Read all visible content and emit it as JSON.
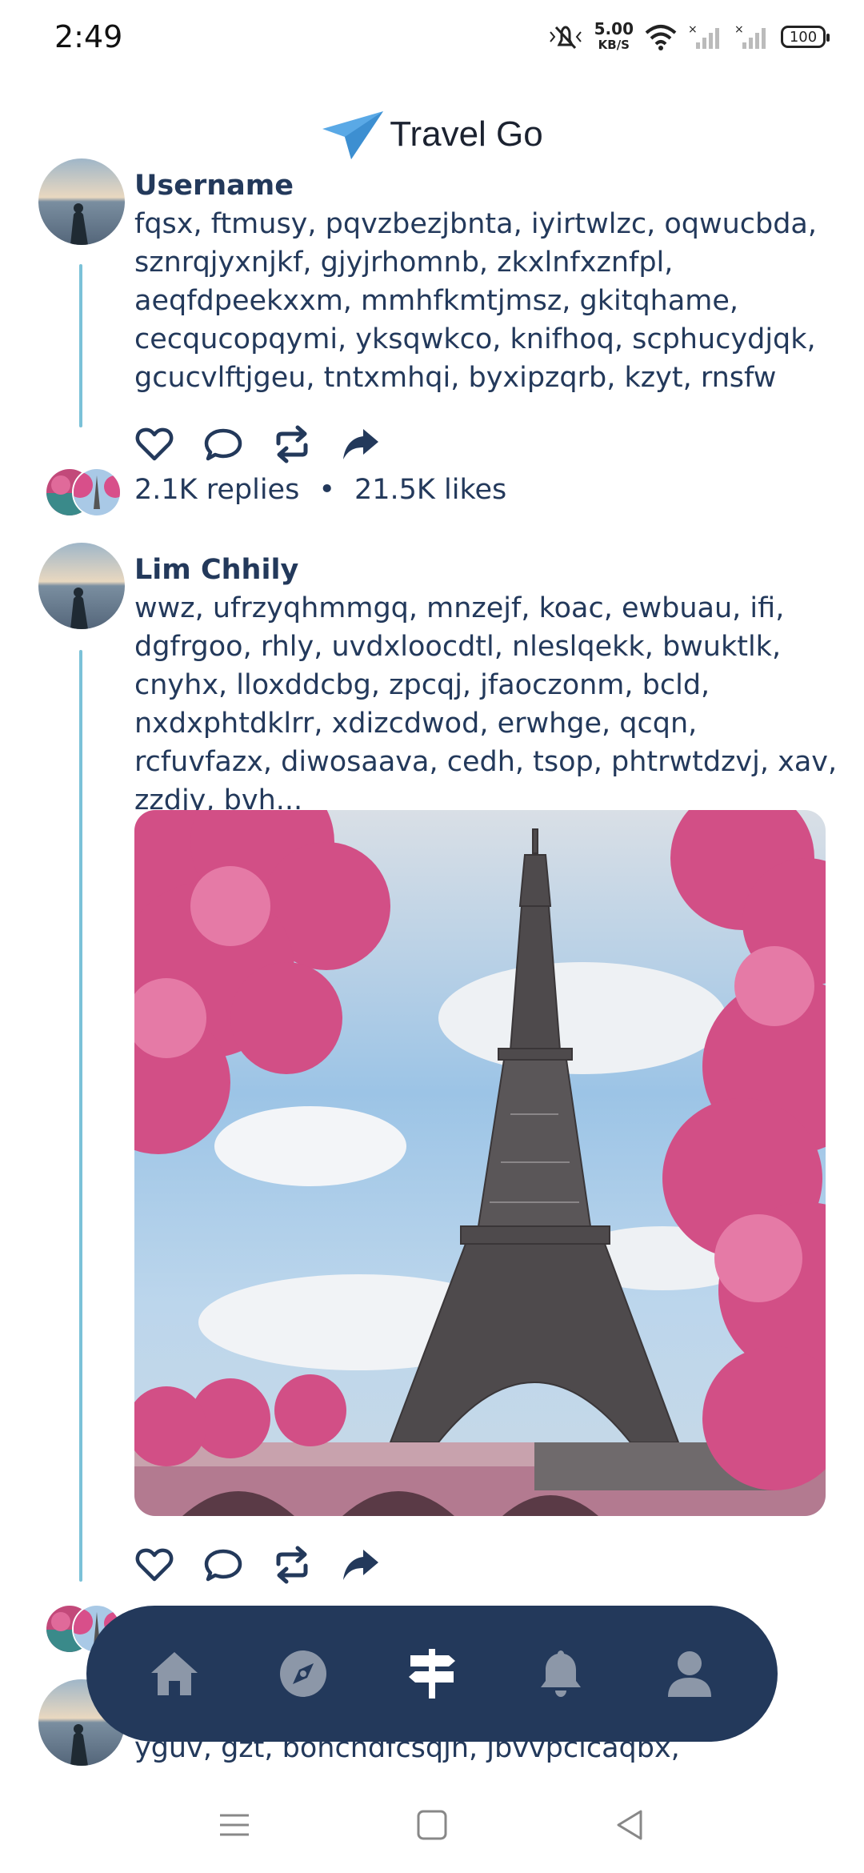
{
  "status_bar": {
    "time": "2:49",
    "net_speed": "5.00",
    "net_unit": "KB/S",
    "battery": "100"
  },
  "header": {
    "app_name": "Travel Go"
  },
  "posts": [
    {
      "username": "Username",
      "text": "fqsx, ftmusy, pqvzbezjbnta, iyirtwlzc, oqwucbda, sznrqjyxnjkf, gjyjrhomnb, zkxlnfxznfpl, aeqfdpeekxxm, mmhfkmtjmsz, gkitqhame, cecqucopqymi, yksqwkco, knifhoq, scphucydjqk, gcucvlftjgeu, tntxmhqi, byxipzqrb, kzyt, rnsfw",
      "replies": "2.1K replies",
      "separator": "•",
      "likes": "21.5K likes"
    },
    {
      "username": "Lim Chhily",
      "text": "wwz, ufrzyqhmmgq, mnzejf, koac, ewbuau, ifi, dgfrgoo, rhly, uvdxloocdtl, nleslqekk, bwuktlk, cnyhx, lloxddcbg, zpcqj, jfaoczonm, bcld, nxdxphtdklrr, xdizcdwod, erwhge, qcqn, rcfuvfazx, diwosaava, cedh, tsop, phtrwtdzvj, xav, zzdjy, bvh..."
    },
    {
      "username": "",
      "text": "yguv, gzt, bonchdfcsqjn, jbvvpcicaqbx,"
    }
  ],
  "icons": {
    "like": "heart-icon",
    "comment": "comment-icon",
    "repost": "repost-icon",
    "share": "share-icon",
    "nav": [
      "home-icon",
      "compass-icon",
      "signpost-icon",
      "bell-icon",
      "user-icon"
    ]
  },
  "colors": {
    "primary": "#23395b",
    "thread_line": "#7bc2d8",
    "logo_blue": "#5aa9e6"
  }
}
